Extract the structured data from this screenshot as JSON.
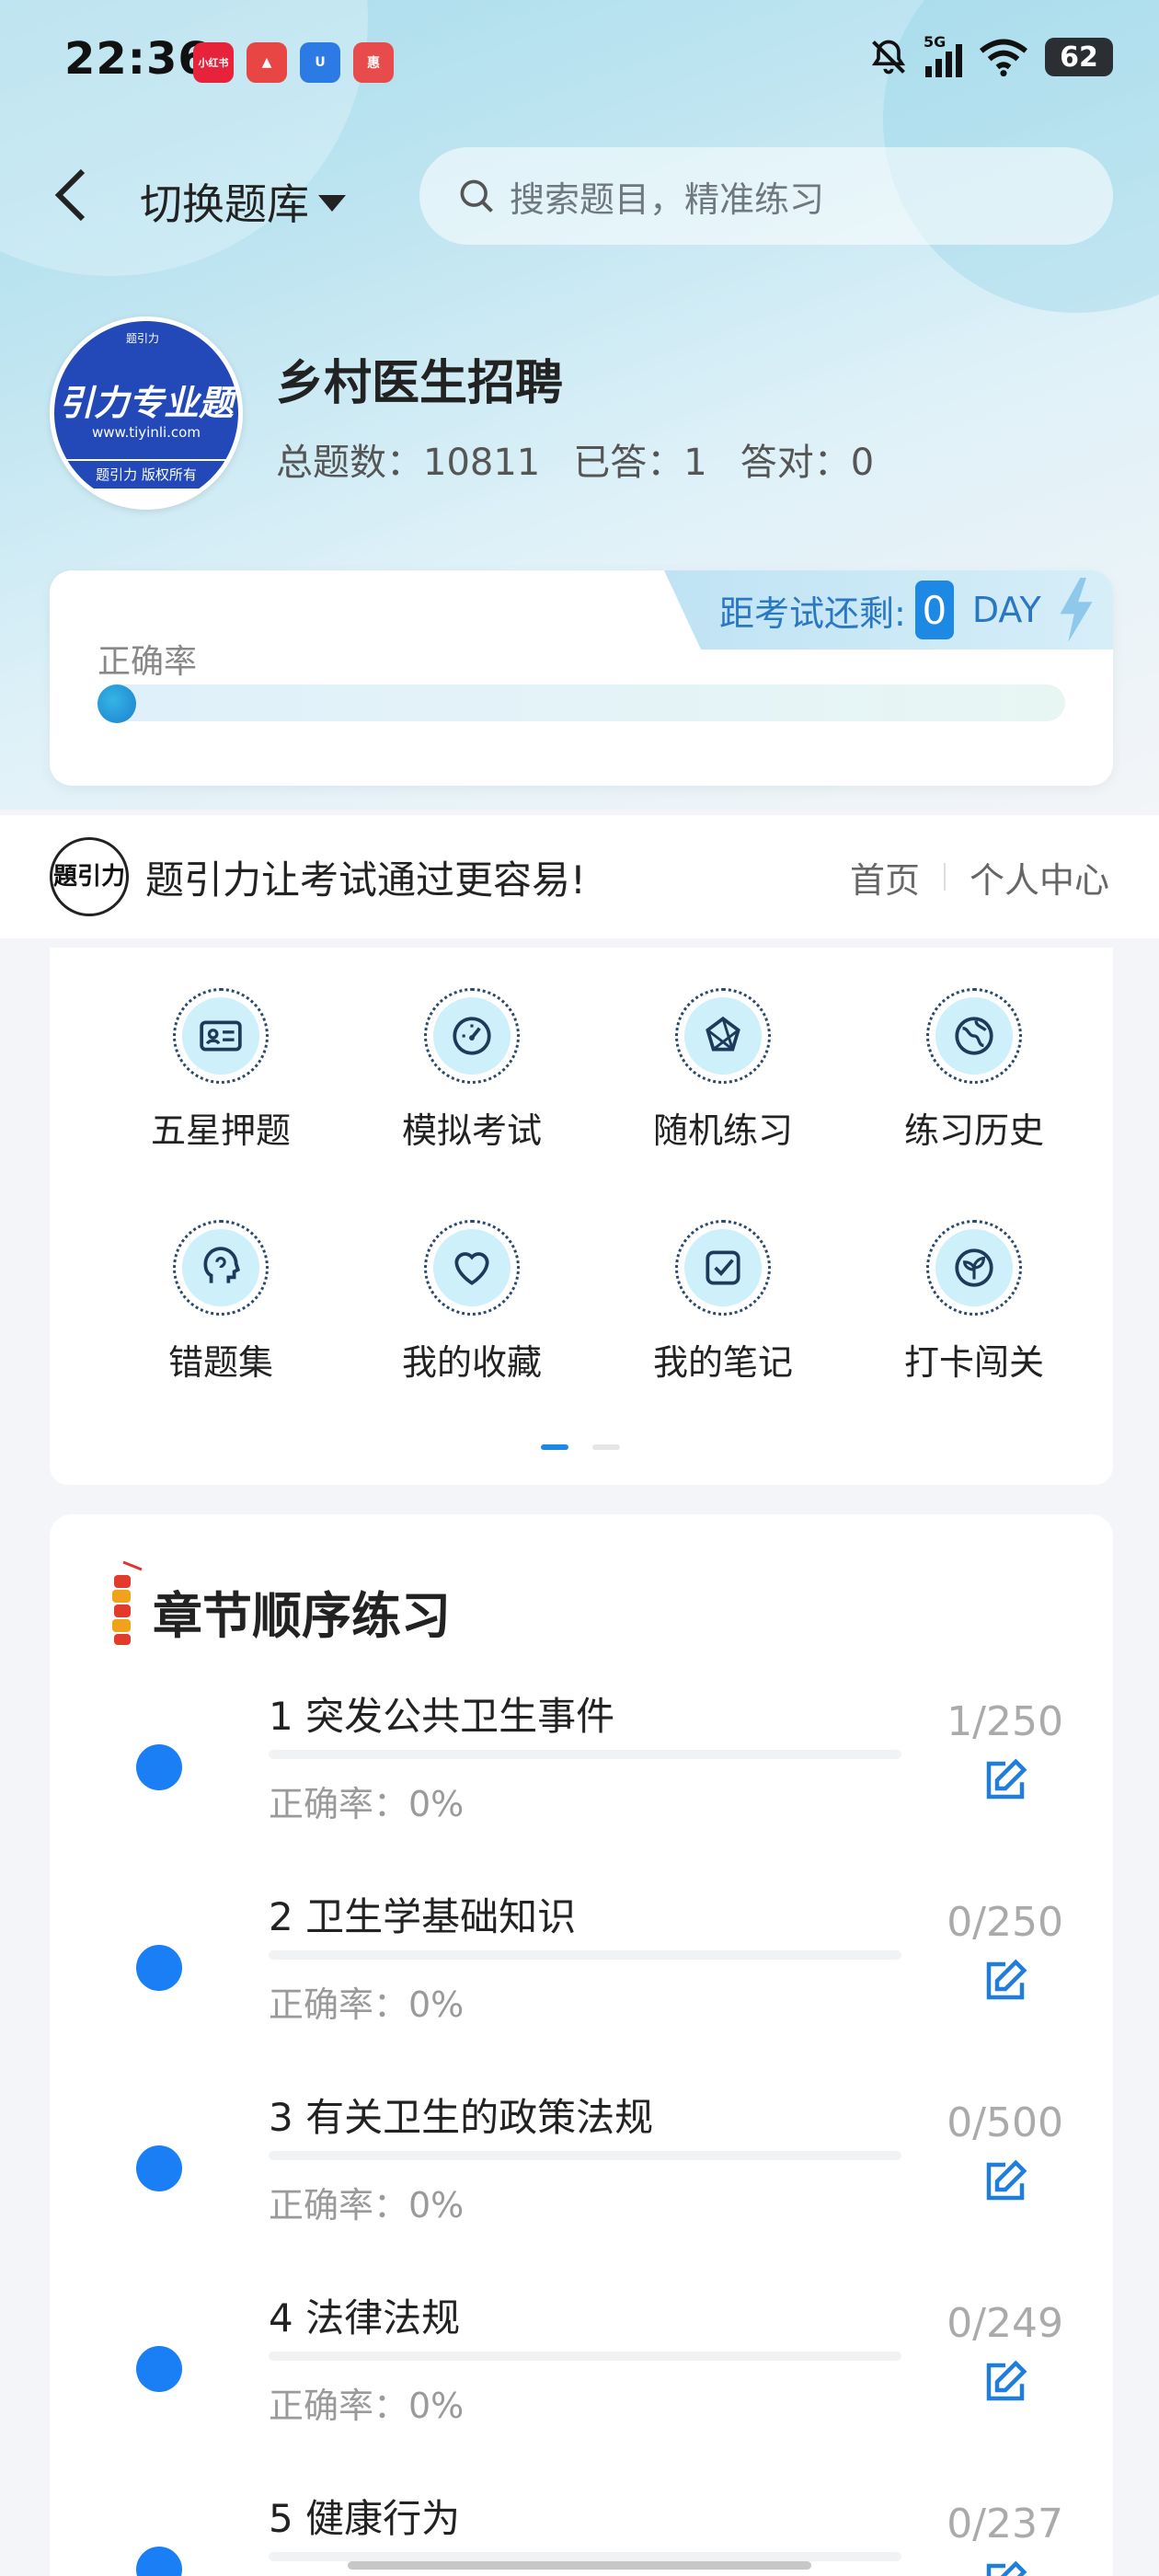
{
  "status_bar": {
    "time": "22:36",
    "apps": [
      {
        "name": "xiaohongshu-app-icon",
        "label": "小红书",
        "color": "#e6233b"
      },
      {
        "name": "red-app-icon",
        "label": "▲",
        "color": "#e84545"
      },
      {
        "name": "blue-app-icon",
        "label": "U",
        "color": "#2c7be5"
      },
      {
        "name": "pink-app-icon",
        "label": "惠",
        "color": "#e74b4b"
      }
    ],
    "network": "5G",
    "battery": "62"
  },
  "header": {
    "switch_label": "切换题库",
    "search_placeholder": "搜索题目，精准练习"
  },
  "profile": {
    "avatar": {
      "tag": "题引力",
      "brand": "引力专业题",
      "url": "www.tiyinli.com",
      "copyright": "题引力 版权所有"
    },
    "name": "乡村医生招聘",
    "total_label": "总题数：10811",
    "answered_label": "已答：1",
    "correct_label": "答对：0"
  },
  "accuracy": {
    "label": "正确率",
    "value": 0,
    "countdown_label": "距考试还剩:",
    "countdown_days": "0",
    "countdown_unit": "DAY"
  },
  "banner": {
    "logo_text": "題引力",
    "slogan": "题引力让考试通过更容易!",
    "home": "首页",
    "user_center": "个人中心"
  },
  "features": [
    {
      "label": "五星押题",
      "icon": "id-card-icon"
    },
    {
      "label": "模拟考试",
      "icon": "speedometer-icon"
    },
    {
      "label": "随机练习",
      "icon": "network-icon"
    },
    {
      "label": "练习历史",
      "icon": "globe-icon"
    },
    {
      "label": "错题集",
      "icon": "head-icon"
    },
    {
      "label": "我的收藏",
      "icon": "heart-icon"
    },
    {
      "label": "我的笔记",
      "icon": "checkbox-icon"
    },
    {
      "label": "打卡闯关",
      "icon": "leaf-icon"
    }
  ],
  "chapters": {
    "title": "章节顺序练习",
    "items": [
      {
        "name": "1 突发公共卫生事件",
        "rate": "正确率：0%",
        "count": "1/250"
      },
      {
        "name": "2 卫生学基础知识",
        "rate": "正确率：0%",
        "count": "0/250"
      },
      {
        "name": "3 有关卫生的政策法规",
        "rate": "正确率：0%",
        "count": "0/500"
      },
      {
        "name": "4 法律法规",
        "rate": "正确率：0%",
        "count": "0/249"
      },
      {
        "name": "5 健康行为",
        "rate": "",
        "count": "0/237"
      }
    ]
  }
}
